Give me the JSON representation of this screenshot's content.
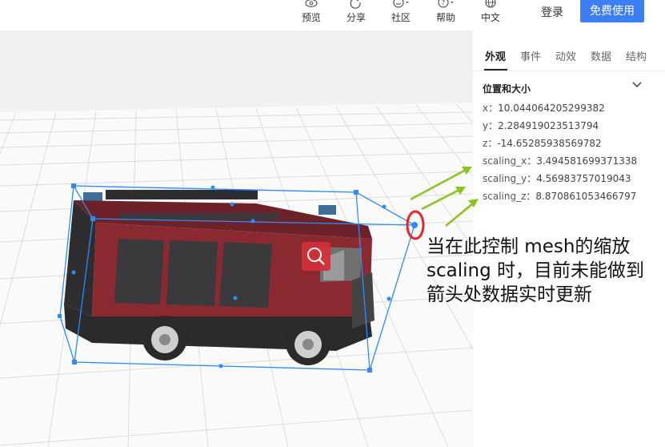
{
  "topbar": {
    "tools": [
      {
        "label": "预览",
        "icon": "eye-icon"
      },
      {
        "label": "分享",
        "icon": "share-icon"
      },
      {
        "label": "社区",
        "icon": "community-icon"
      },
      {
        "label": "帮助",
        "icon": "help-icon"
      },
      {
        "label": "中文",
        "icon": "globe-icon"
      }
    ],
    "login_label": "登录",
    "free_use_label": "免费使用"
  },
  "panel": {
    "tabs": [
      {
        "label": "外观",
        "active": true
      },
      {
        "label": "事件",
        "active": false
      },
      {
        "label": "动效",
        "active": false
      },
      {
        "label": "数据",
        "active": false
      },
      {
        "label": "结构",
        "active": false
      }
    ],
    "section_title": "位置和大小",
    "properties": [
      {
        "key": "x",
        "sep": "：",
        "value": "10.044064205299382"
      },
      {
        "key": "y",
        "sep": "：",
        "value": "2.284919023513794"
      },
      {
        "key": "z",
        "sep": "：",
        "value": "-14.65285938569782"
      },
      {
        "key": "scaling_x",
        "sep": "：",
        "value": "3.494581699371338"
      },
      {
        "key": "scaling_y",
        "sep": "：",
        "value": "4.56983757019043"
      },
      {
        "key": "scaling_z",
        "sep": "：",
        "value": "8.870861053466797"
      }
    ]
  },
  "annotation": {
    "lines": [
      "当在此控制 mesh的缩放",
      "scaling 时，目前未能做到",
      "箭头处数据实时更新"
    ]
  },
  "colors": {
    "accent": "#3d7ef5",
    "annotation_arrow": "#8fc31f",
    "annotation_circle": "#ee2222",
    "truck_body": "#8a2a30",
    "bbox": "#2a8cff"
  }
}
